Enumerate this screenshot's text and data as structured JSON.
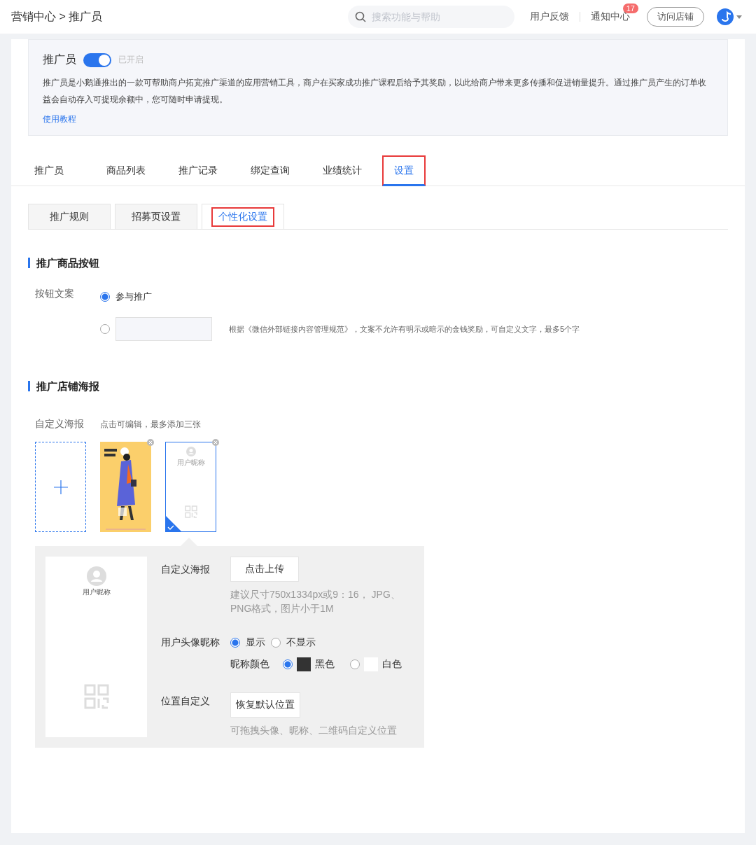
{
  "header": {
    "breadcrumb": "营销中心 > 推广员",
    "search": {
      "placeholder": "搜索功能与帮助"
    },
    "links": [
      {
        "label": "用户反馈"
      },
      {
        "label": "通知中心",
        "badge": "17"
      }
    ],
    "visit_button": "访问店铺"
  },
  "intro": {
    "title": "推广员",
    "enabled": true,
    "status": "已开启",
    "description": "推广员是小鹅通推出的一款可帮助商户拓宽推广渠道的应用营销工具，商户在买家成功推广课程后给予其奖励，以此给商户带来更多传播和促进销量提升。通过推广员产生的订单收益会自动存入可提现余额中，您可随时申请提现。",
    "link": "使用教程"
  },
  "tabs": [
    {
      "label": "推广员",
      "selected": false,
      "highlighted": false
    },
    {
      "label": "商品列表",
      "selected": false,
      "highlighted": false
    },
    {
      "label": "推广记录",
      "selected": false,
      "highlighted": false
    },
    {
      "label": "绑定查询",
      "selected": false,
      "highlighted": false
    },
    {
      "label": "业绩统计",
      "selected": false,
      "highlighted": false
    },
    {
      "label": "设置",
      "selected": true,
      "highlighted": true
    }
  ],
  "subtabs": [
    {
      "label": "推广规则",
      "selected": false,
      "highlighted": false
    },
    {
      "label": "招募页设置",
      "selected": false,
      "highlighted": false
    },
    {
      "label": "个性化设置",
      "selected": true,
      "highlighted": true
    }
  ],
  "button_section": {
    "title": "推广商品按钮",
    "label": "按钮文案",
    "options": [
      {
        "kind": "text",
        "label": "参与推广",
        "selected": true
      },
      {
        "kind": "input",
        "selected": false,
        "hint": "根据《微信外部链接内容管理规范》，文案不允许有明示或暗示的金钱奖励，可自定义文字，最多5个字"
      }
    ]
  },
  "poster_section": {
    "title": "推广店铺海报",
    "label": "自定义海报",
    "hint": "点击可编辑，最多添加三张",
    "posters": [
      {
        "kind": "add",
        "selected": false
      },
      {
        "kind": "picture",
        "selected": false
      },
      {
        "kind": "template",
        "selected": true,
        "nickname": "用户昵称"
      }
    ]
  },
  "editor": {
    "preview_nickname": "用户昵称",
    "upload_label": "自定义海报",
    "upload_button": "点击上传",
    "upload_hint": "建议尺寸750x1334px或9：16， JPG、PNG格式，图片小于1M",
    "avatar_label": "用户头像昵称",
    "avatar_options": [
      {
        "label": "显示",
        "selected": true
      },
      {
        "label": "不显示",
        "selected": false
      }
    ],
    "color_label": "昵称颜色",
    "color_options": [
      {
        "label": "黑色",
        "color": "#333333",
        "selected": true
      },
      {
        "label": "白色",
        "color": "#ffffff",
        "selected": false
      }
    ],
    "position_label": "位置自定义",
    "reset_button": "恢复默认位置",
    "position_hint": "可拖拽头像、昵称、二维码自定义位置"
  }
}
